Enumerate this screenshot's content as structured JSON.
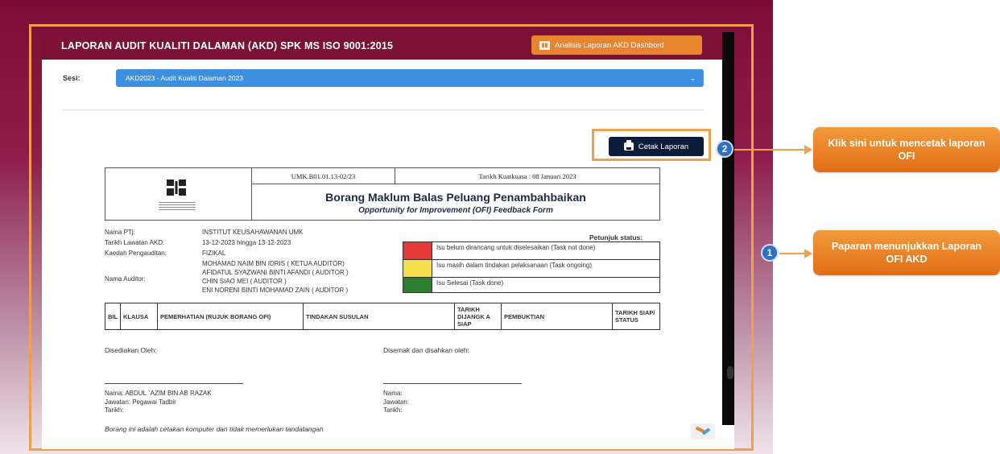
{
  "header": {
    "title": "LAPORAN AUDIT KUALITI DALAMAN (AKD) SPK MS ISO 9001:2015",
    "dashboard_button": "Analisis Laporan AKD Dashbord"
  },
  "sesi": {
    "label": "Sesi:",
    "selected": "AKD2023 - Audit Kualiti Dalaman 2023"
  },
  "print_button": "Cetak Laporan",
  "form": {
    "reference": "UMK.B01.01.13-02/23",
    "effective_date": "Tarikh Kuatkuasa : 08 Januari 2023",
    "title": "Borang Maklum Balas Peluang Penambahbaikan",
    "subtitle": "Opportunity for Improvement (OFI) Feedback Form",
    "ptj_label": "Nama PTj:",
    "ptj_value": "INSTITUT KEUSAHAWANAN UMK",
    "visit_label": "Tarikh Lawatan AKD:",
    "visit_value": "13-12-2023 hingga 13-12-2023",
    "method_label": "Kaedah Pengauditan:",
    "method_value": "FIZIKAL",
    "auditor_label": "Nama Auditor:",
    "auditors": [
      "MOHAMAD NAIM BIN IDRIS ( KETUA AUDITOR)",
      "AFIDATUL SYAZWANI BINTI AFANDI ( AUDITOR )",
      "CHIN SIAO MEI ( AUDITOR )",
      "ENI NORENI BINTI MOHAMAD ZAIN ( AUDITOR )"
    ],
    "status_title": "Petunjuk status:",
    "status_legend": [
      {
        "color": "#e53935",
        "text": "Isu belum dirancang untuk diselesaikan (Task not done)"
      },
      {
        "color": "#f5e14b",
        "text": "Isu masih dalam tindakan pelaksanaan (Task ongoing)"
      },
      {
        "color": "#2e7d32",
        "text": "Isu Selesai (Task done)"
      }
    ],
    "table_headers": [
      "BIL",
      "KLAUSA",
      "PEMERHATIAN (RUJUK BORANG OFI)",
      "TINDAKAN SUSULAN",
      "TARIKH DIJANGK A SIAP",
      "PEMBUKTIAN",
      "TARIKH SIAP/ STATUS"
    ],
    "prepared_by": "Disediakan Oleh:",
    "reviewed_by": "Disemak dan disahkan oleh:",
    "left_sign": [
      "Nama: ABDUL `AZIM BIN AB RAZAK",
      "Jawatan: Pegawai Tadbir",
      "Tarikh:"
    ],
    "right_sign": [
      "Nama:",
      "Jawatan:",
      "Tarikh:"
    ],
    "note": "Borang ini adalah cetakan komputer dan tidak memerlukan tandatangan"
  },
  "annotations": {
    "badge_1": "1",
    "badge_2": "2",
    "callout_1": "Paparan menunjukkan Laporan OFI AKD",
    "callout_2": "Klik sini untuk mencetak laporan OFI"
  }
}
